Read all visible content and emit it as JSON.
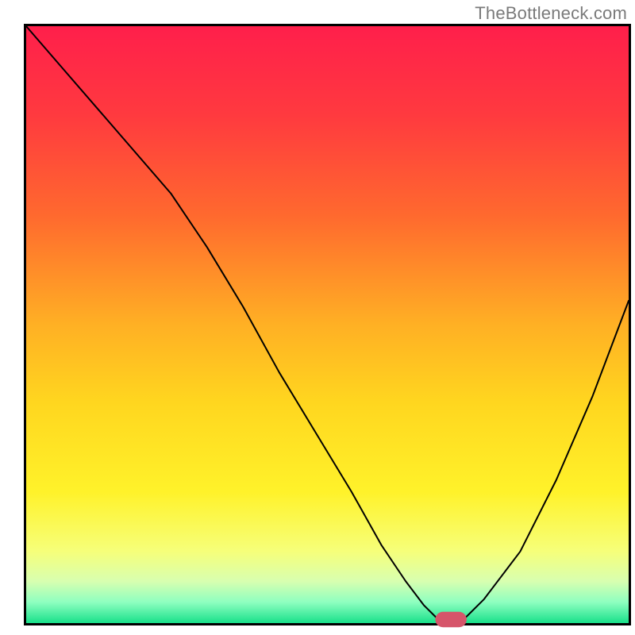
{
  "watermark": "TheBottleneck.com",
  "chart_data": {
    "type": "line",
    "title": "",
    "xlabel": "",
    "ylabel": "",
    "xlim": [
      0,
      100
    ],
    "ylim": [
      0,
      100
    ],
    "grid": false,
    "legend": false,
    "background_gradient_stops": [
      {
        "offset": 0.0,
        "color": "#ff1f4b"
      },
      {
        "offset": 0.15,
        "color": "#ff3a3f"
      },
      {
        "offset": 0.32,
        "color": "#ff6a2e"
      },
      {
        "offset": 0.5,
        "color": "#ffb024"
      },
      {
        "offset": 0.63,
        "color": "#ffd61f"
      },
      {
        "offset": 0.78,
        "color": "#fff22a"
      },
      {
        "offset": 0.88,
        "color": "#f6ff7a"
      },
      {
        "offset": 0.93,
        "color": "#d8ffb0"
      },
      {
        "offset": 0.965,
        "color": "#8effc0"
      },
      {
        "offset": 1.0,
        "color": "#19e08a"
      }
    ],
    "series": [
      {
        "name": "bottleneck-curve",
        "color": "#000000",
        "width": 2,
        "x": [
          0,
          6,
          12,
          18,
          24,
          30,
          36,
          42,
          48,
          54,
          59,
          63,
          66,
          68,
          70,
          72,
          76,
          82,
          88,
          94,
          100
        ],
        "y": [
          100,
          93,
          86,
          79,
          72,
          63,
          53,
          42,
          32,
          22,
          13,
          7,
          3,
          1,
          0,
          0,
          4,
          12,
          24,
          38,
          54
        ]
      }
    ],
    "marker": {
      "name": "optimum-marker",
      "color": "#d6556a",
      "x_center": 70.5,
      "y_center": 0.6,
      "rx": 2.6,
      "ry": 1.3
    },
    "border": {
      "color": "#000000",
      "width": 3
    }
  }
}
